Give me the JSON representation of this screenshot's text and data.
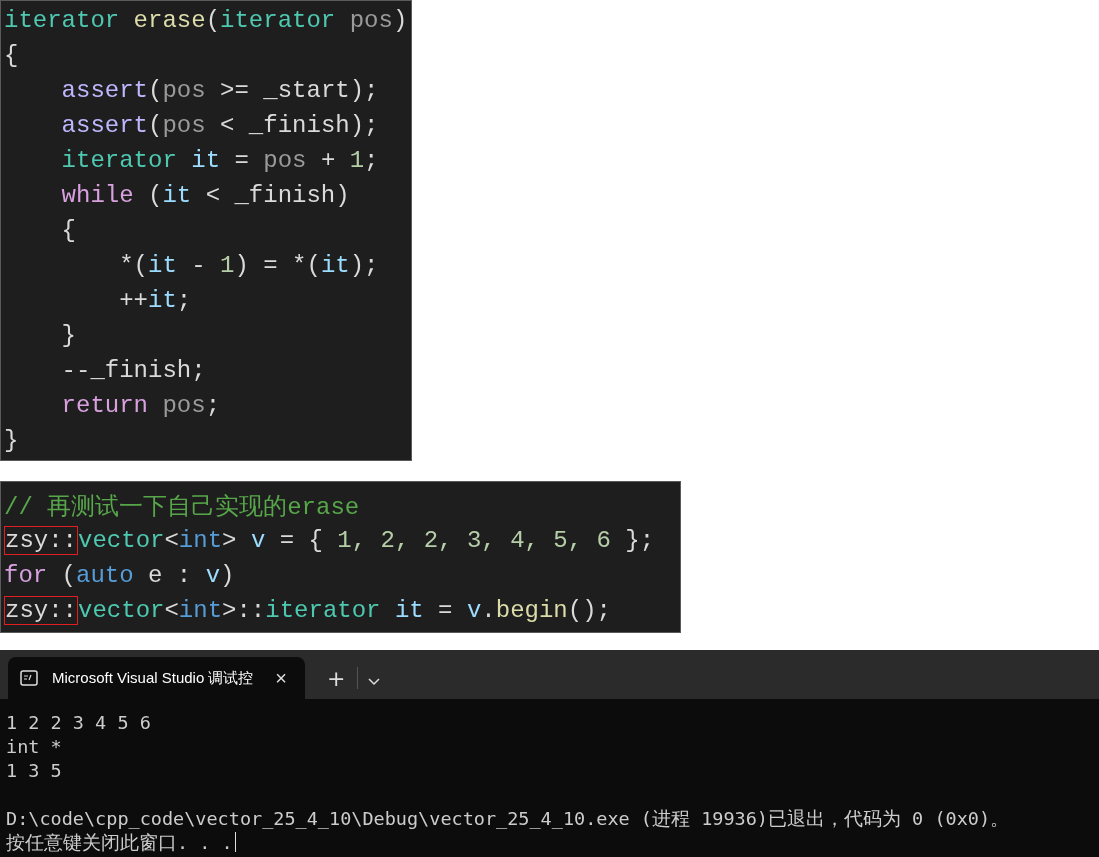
{
  "code_snippets": [
    {
      "lines": [
        {
          "tokens": [
            {
              "kind": "type",
              "text": "iterator"
            },
            {
              "kind": "func",
              "text": " erase"
            },
            {
              "kind": "plain",
              "text": "("
            },
            {
              "kind": "type",
              "text": "iterator"
            },
            {
              "kind": "param",
              "text": " pos"
            },
            {
              "kind": "plain",
              "text": ")"
            }
          ]
        },
        {
          "tokens": [
            {
              "kind": "plain",
              "text": "{"
            }
          ]
        },
        {
          "tokens": [
            {
              "kind": "macro",
              "text": "    assert"
            },
            {
              "kind": "plain",
              "text": "("
            },
            {
              "kind": "param",
              "text": "pos"
            },
            {
              "kind": "plain",
              "text": " >= _start);"
            }
          ]
        },
        {
          "tokens": [
            {
              "kind": "macro",
              "text": "    assert"
            },
            {
              "kind": "plain",
              "text": "("
            },
            {
              "kind": "param",
              "text": "pos"
            },
            {
              "kind": "plain",
              "text": " < _finish);"
            }
          ]
        },
        {
          "tokens": [
            {
              "kind": "type",
              "text": "    iterator"
            },
            {
              "kind": "local",
              "text": " it"
            },
            {
              "kind": "plain",
              "text": " = "
            },
            {
              "kind": "param",
              "text": "pos"
            },
            {
              "kind": "plain",
              "text": " + "
            },
            {
              "kind": "number",
              "text": "1"
            },
            {
              "kind": "plain",
              "text": ";"
            }
          ]
        },
        {
          "tokens": [
            {
              "kind": "keyword",
              "text": "    while"
            },
            {
              "kind": "plain",
              "text": " ("
            },
            {
              "kind": "local",
              "text": "it"
            },
            {
              "kind": "plain",
              "text": " < _finish)"
            }
          ]
        },
        {
          "tokens": [
            {
              "kind": "plain",
              "text": "    {"
            }
          ]
        },
        {
          "tokens": [
            {
              "kind": "plain",
              "text": "        *("
            },
            {
              "kind": "local",
              "text": "it"
            },
            {
              "kind": "plain",
              "text": " - "
            },
            {
              "kind": "number",
              "text": "1"
            },
            {
              "kind": "plain",
              "text": ") = *("
            },
            {
              "kind": "local",
              "text": "it"
            },
            {
              "kind": "plain",
              "text": ");"
            }
          ]
        },
        {
          "tokens": [
            {
              "kind": "plain",
              "text": "        ++"
            },
            {
              "kind": "local",
              "text": "it"
            },
            {
              "kind": "plain",
              "text": ";"
            }
          ]
        },
        {
          "tokens": [
            {
              "kind": "plain",
              "text": "    }"
            }
          ]
        },
        {
          "tokens": [
            {
              "kind": "plain",
              "text": "    --_finish;"
            }
          ]
        },
        {
          "tokens": [
            {
              "kind": "keyword",
              "text": "    return"
            },
            {
              "kind": "param",
              "text": " pos"
            },
            {
              "kind": "plain",
              "text": ";"
            }
          ]
        },
        {
          "tokens": [
            {
              "kind": "plain",
              "text": "}"
            }
          ]
        }
      ]
    },
    {
      "lines": [
        {
          "tokens": [
            {
              "kind": "comment",
              "text": "// 再测试一下自己实现的erase"
            }
          ]
        },
        {
          "tokens": [
            {
              "kind": "plain",
              "text": "zsy::",
              "highlighted": true
            },
            {
              "kind": "type",
              "text": "vector"
            },
            {
              "kind": "plain",
              "text": "<"
            },
            {
              "kind": "builtin",
              "text": "int"
            },
            {
              "kind": "plain",
              "text": "> "
            },
            {
              "kind": "local",
              "text": "v"
            },
            {
              "kind": "plain",
              "text": " = { "
            },
            {
              "kind": "number",
              "text": "1, 2, 2, 3, 4, 5, 6"
            },
            {
              "kind": "plain",
              "text": " };"
            }
          ]
        },
        {
          "tokens": [
            {
              "kind": "keyword",
              "text": "for"
            },
            {
              "kind": "plain",
              "text": " ("
            },
            {
              "kind": "builtin",
              "text": "auto"
            },
            {
              "kind": "plain",
              "text": " e : "
            },
            {
              "kind": "local",
              "text": "v"
            },
            {
              "kind": "plain",
              "text": ")"
            }
          ]
        },
        {
          "tokens": [
            {
              "kind": "plain",
              "text": "zsy::",
              "highlighted": true
            },
            {
              "kind": "type",
              "text": "vector"
            },
            {
              "kind": "plain",
              "text": "<"
            },
            {
              "kind": "builtin",
              "text": "int"
            },
            {
              "kind": "plain",
              "text": ">::"
            },
            {
              "kind": "type",
              "text": "iterator"
            },
            {
              "kind": "local",
              "text": " it"
            },
            {
              "kind": "plain",
              "text": " = "
            },
            {
              "kind": "local",
              "text": "v"
            },
            {
              "kind": "plain",
              "text": "."
            },
            {
              "kind": "func",
              "text": "begin"
            },
            {
              "kind": "plain",
              "text": "();"
            }
          ]
        }
      ]
    }
  ],
  "terminal": {
    "tab": {
      "title": "Microsoft Visual Studio 调试控",
      "selected": true,
      "close": "×"
    },
    "new_tab": "+",
    "output_blocks": [
      {
        "lines": [
          {
            "text": "1 2 2 3 4 5 6"
          },
          {
            "text": "int *"
          },
          {
            "text": "1 3 5"
          }
        ]
      },
      {
        "lines": [
          {
            "text": "D:\\code\\cpp_code\\vector_25_4_10\\Debug\\vector_25_4_10.exe (进程 19936)已退出，代码为 0 (0x0)。"
          },
          {
            "text": "按任意键关闭此窗口. . .",
            "cursor": true
          }
        ]
      }
    ]
  }
}
